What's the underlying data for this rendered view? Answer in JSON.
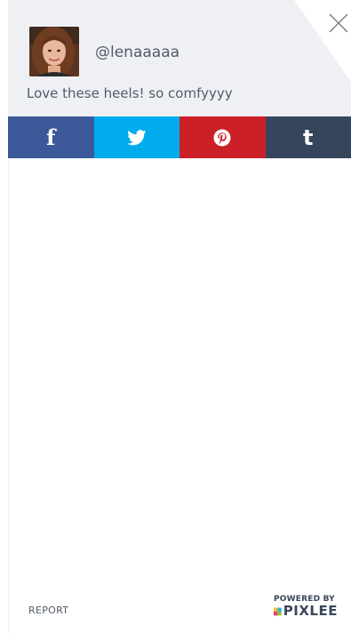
{
  "header": {
    "username": "@lenaaaaa",
    "caption": "Love these heels! so comfyyyy"
  },
  "share": {
    "facebook_glyph": "f",
    "tumblr_glyph": "t",
    "colors": {
      "facebook": "#3b5998",
      "twitter": "#00aced",
      "pinterest": "#cb2027",
      "tumblr": "#35465c"
    },
    "icons": [
      "facebook-icon",
      "twitter-icon",
      "pinterest-icon",
      "tumblr-icon"
    ]
  },
  "footer": {
    "report_label": "REPORT",
    "powered_by": "POWERED BY",
    "brand": "PIXLEE"
  }
}
